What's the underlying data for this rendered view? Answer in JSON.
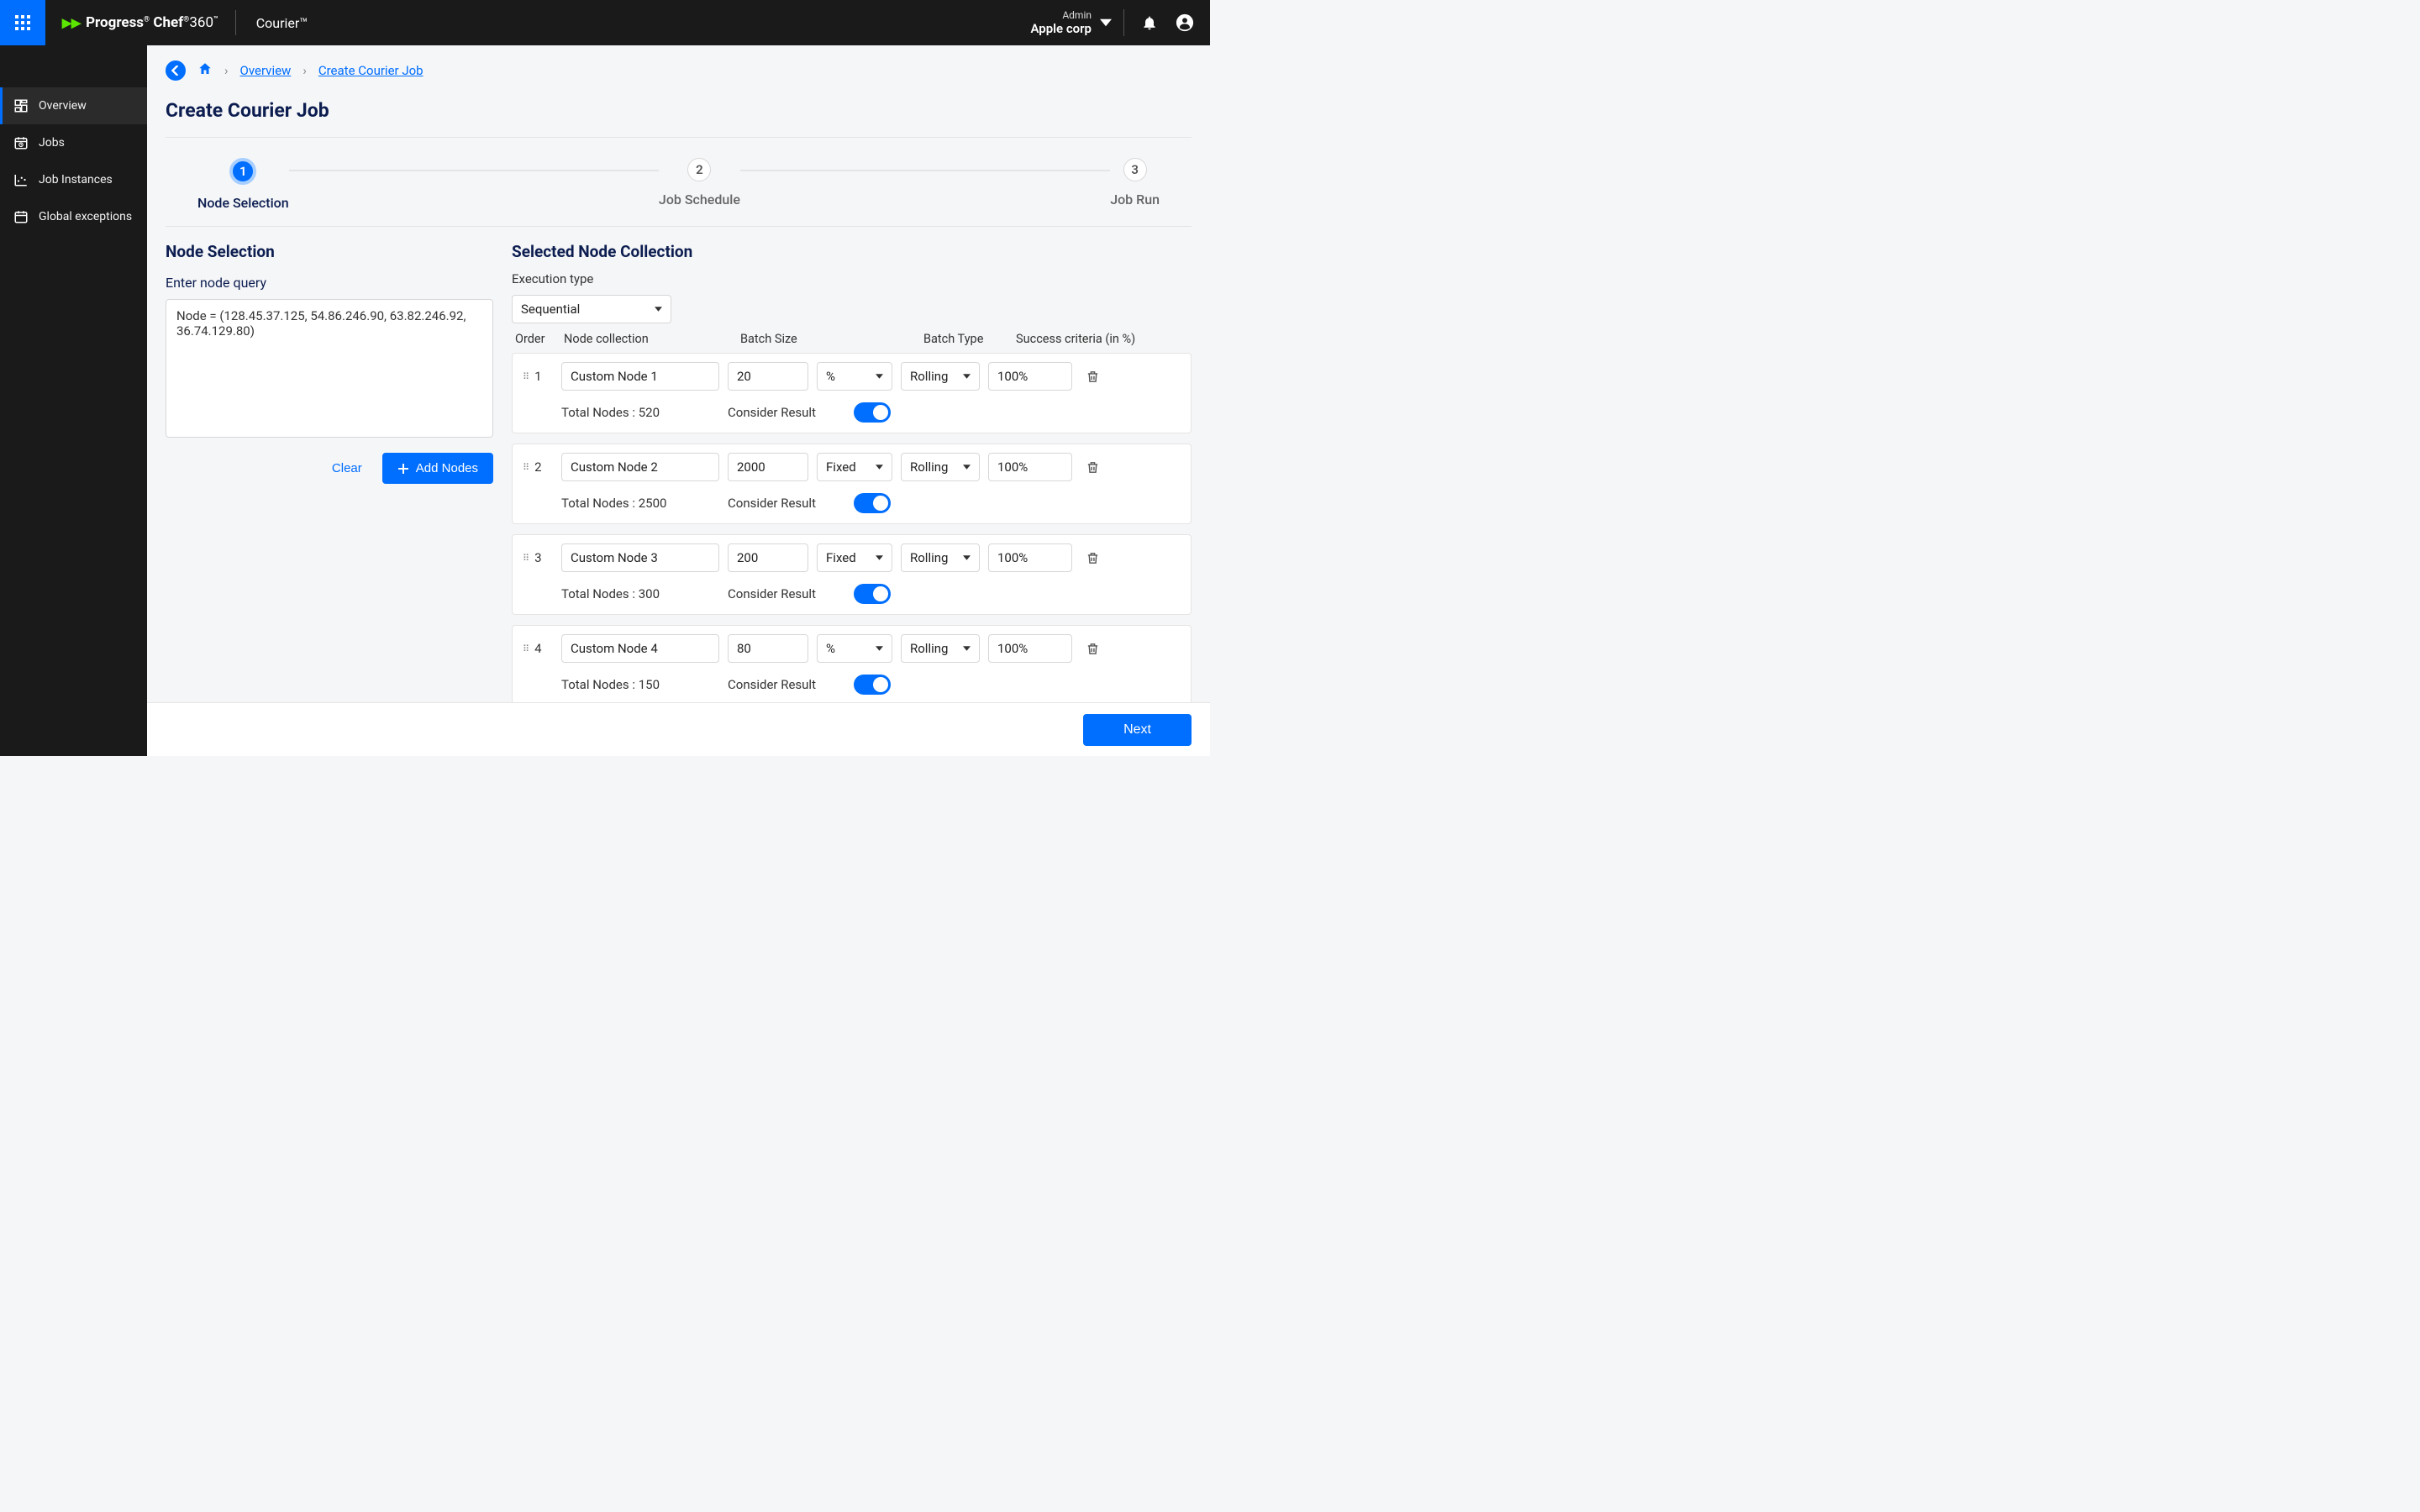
{
  "header": {
    "brand_prefix": "Progress",
    "brand_chef": "Chef",
    "brand_suffix": "360",
    "sub_product": "Courier™",
    "role_label": "Admin",
    "org_name": "Apple corp"
  },
  "sidebar": {
    "items": [
      {
        "label": "Overview"
      },
      {
        "label": "Jobs"
      },
      {
        "label": "Job Instances"
      },
      {
        "label": "Global exceptions"
      }
    ]
  },
  "breadcrumb": {
    "items": [
      "Overview",
      "Create Courier Job"
    ]
  },
  "page_title": "Create Courier Job",
  "stepper": {
    "steps": [
      {
        "num": "1",
        "label": "Node Selection"
      },
      {
        "num": "2",
        "label": "Job Schedule"
      },
      {
        "num": "3",
        "label": "Job Run"
      }
    ]
  },
  "left": {
    "heading": "Node Selection",
    "query_label": "Enter node query",
    "query_value": "Node = (128.45.37.125, 54.86.246.90, 63.82.246.92, 36.74.129.80)",
    "clear_label": "Clear",
    "add_label": "Add Nodes"
  },
  "right": {
    "heading": "Selected Node Collection",
    "exec_label": "Execution type",
    "exec_value": "Sequential",
    "columns": {
      "order": "Order",
      "coll": "Node collection",
      "batch": "Batch Size",
      "btype": "Batch Type",
      "succ": "Success criteria (in %)"
    },
    "consider_label": "Consider Result",
    "total_prefix": "Total Nodes : ",
    "rows": [
      {
        "order": "1",
        "name": "Custom Node 1",
        "batch": "20",
        "unit": "%",
        "btype": "Rolling",
        "succ": "100%",
        "total": "520"
      },
      {
        "order": "2",
        "name": "Custom Node 2",
        "batch": "2000",
        "unit": "Fixed",
        "btype": "Rolling",
        "succ": "100%",
        "total": "2500"
      },
      {
        "order": "3",
        "name": "Custom Node 3",
        "batch": "200",
        "unit": "Fixed",
        "btype": "Rolling",
        "succ": "100%",
        "total": "300"
      },
      {
        "order": "4",
        "name": "Custom Node 4",
        "batch": "80",
        "unit": "%",
        "btype": "Rolling",
        "succ": "100%",
        "total": "150"
      }
    ]
  },
  "footer": {
    "next_label": "Next"
  }
}
